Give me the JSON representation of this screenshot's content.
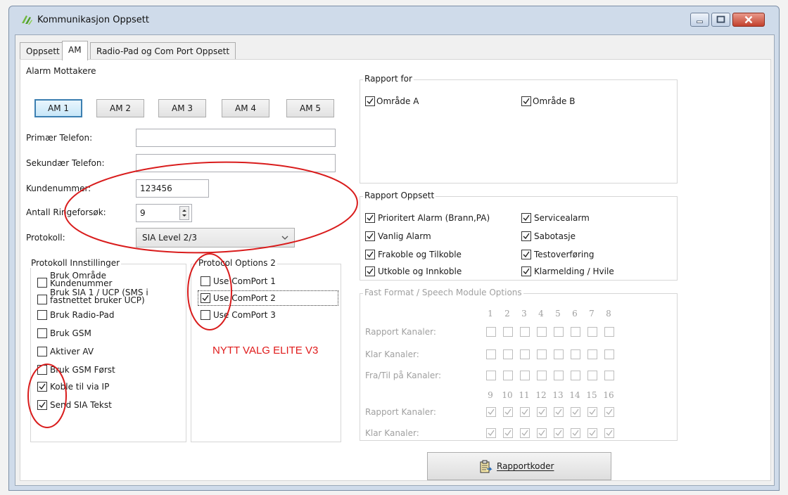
{
  "window": {
    "title": "Kommunikasjon Oppsett"
  },
  "tabs": [
    {
      "label": "Oppsett",
      "active": false
    },
    {
      "label": "AM",
      "active": true
    },
    {
      "label": "Radio-Pad og Com Port Oppsett",
      "active": false
    }
  ],
  "alarm_group": {
    "title": "Alarm Mottakere",
    "am_buttons": [
      {
        "label": "AM 1",
        "selected": true
      },
      {
        "label": "AM 2",
        "selected": false
      },
      {
        "label": "AM 3",
        "selected": false
      },
      {
        "label": "AM 4",
        "selected": false
      },
      {
        "label": "AM 5",
        "selected": false
      }
    ],
    "primary_phone_label": "Primær Telefon:",
    "primary_phone_value": "",
    "secondary_phone_label": "Sekundær Telefon:",
    "secondary_phone_value": "",
    "customer_number_label": "Kundenummer:",
    "customer_number_value": "123456",
    "ring_attempts_label": "Antall Ringeforsøk:",
    "ring_attempts_value": "9",
    "protocol_label": "Protokoll:",
    "protocol_value": "SIA Level 2/3"
  },
  "protocol_settings": {
    "title": "Protokoll Innstillinger",
    "items": [
      {
        "label": "Bruk Område Kundenummer",
        "checked": false
      },
      {
        "label": "Bruk SIA 1 / UCP (SMS i fastnettet bruker UCP)",
        "checked": false
      },
      {
        "label": "Bruk Radio-Pad",
        "checked": false
      },
      {
        "label": "Bruk GSM",
        "checked": false
      },
      {
        "label": "Aktiver AV",
        "checked": false
      },
      {
        "label": "Bruk GSM Først",
        "checked": false
      },
      {
        "label": "Koble til via IP",
        "checked": true
      },
      {
        "label": "Send SIA Tekst",
        "checked": true
      }
    ]
  },
  "protocol_options": {
    "title": "Protocol Options 2",
    "items": [
      {
        "label": "Use ComPort 1",
        "checked": false
      },
      {
        "label": "Use ComPort 2",
        "checked": true
      },
      {
        "label": "Use ComPort 3",
        "checked": false
      }
    ]
  },
  "report_for": {
    "title": "Rapport for",
    "items": [
      {
        "label": "Område A",
        "checked": true
      },
      {
        "label": "Område B",
        "checked": true
      }
    ]
  },
  "report_setup": {
    "title": "Rapport Oppsett",
    "items": [
      {
        "label": "Prioritert Alarm (Brann,PA)",
        "checked": true
      },
      {
        "label": "Servicealarm",
        "checked": true
      },
      {
        "label": "Vanlig Alarm",
        "checked": true
      },
      {
        "label": "Sabotasje",
        "checked": true
      },
      {
        "label": "Frakoble og Tilkoble",
        "checked": true
      },
      {
        "label": "Testoverføring",
        "checked": true
      },
      {
        "label": "Utkoble og Innkoble",
        "checked": true
      },
      {
        "label": "Klarmelding / Hvile",
        "checked": true
      }
    ]
  },
  "fast_format": {
    "title": "Fast Format / Speech Module Options",
    "channels_top": [
      "1",
      "2",
      "3",
      "4",
      "5",
      "6",
      "7",
      "8"
    ],
    "channels_bottom": [
      "9",
      "10",
      "11",
      "12",
      "13",
      "14",
      "15",
      "16"
    ],
    "rows_top": [
      {
        "label": "Rapport Kanaler:",
        "checked": false
      },
      {
        "label": "Klar Kanaler:",
        "checked": false
      },
      {
        "label": "Fra/Til på Kanaler:",
        "checked": false
      }
    ],
    "rows_bottom": [
      {
        "label": "Rapport Kanaler:",
        "checked": true
      },
      {
        "label": "Klar Kanaler:",
        "checked": true
      }
    ]
  },
  "report_codes_button": "Rapportkoder",
  "annotation": {
    "text": "NYTT VALG ELITE V3",
    "color": "#e01b1b"
  }
}
